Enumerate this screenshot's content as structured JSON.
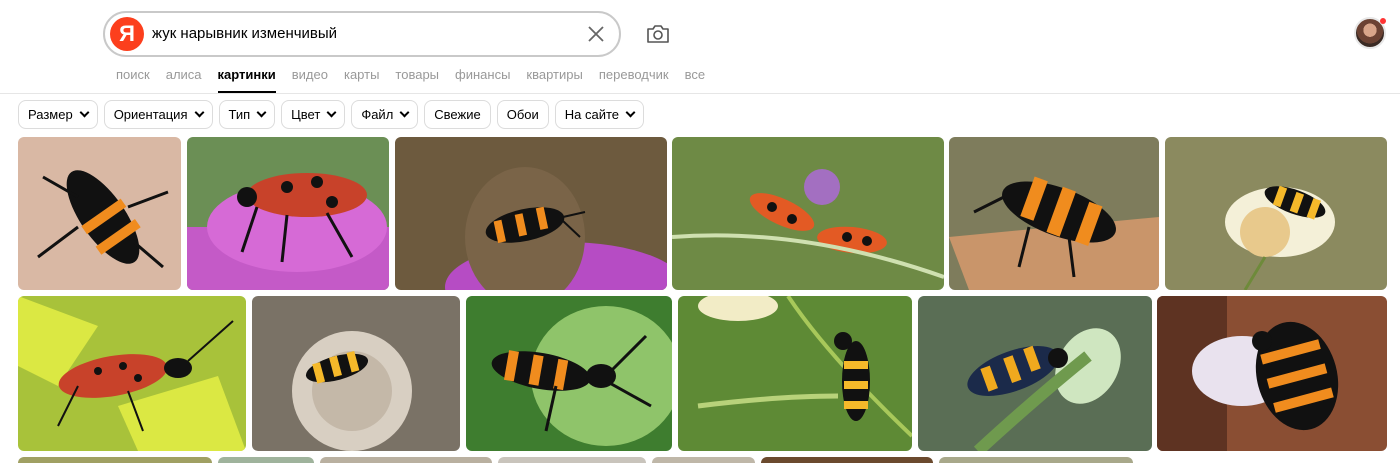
{
  "search": {
    "query": "жук нарывник изменчивый",
    "logo_letter": "Я"
  },
  "tabs": [
    {
      "label": "поиск",
      "active": false
    },
    {
      "label": "алиса",
      "active": false
    },
    {
      "label": "картинки",
      "active": true
    },
    {
      "label": "видео",
      "active": false
    },
    {
      "label": "карты",
      "active": false
    },
    {
      "label": "товары",
      "active": false
    },
    {
      "label": "финансы",
      "active": false
    },
    {
      "label": "квартиры",
      "active": false
    },
    {
      "label": "переводчик",
      "active": false
    },
    {
      "label": "все",
      "active": false
    }
  ],
  "filters": [
    {
      "label": "Размер",
      "dropdown": true
    },
    {
      "label": "Ориентация",
      "dropdown": true
    },
    {
      "label": "Тип",
      "dropdown": true
    },
    {
      "label": "Цвет",
      "dropdown": true
    },
    {
      "label": "Файл",
      "dropdown": true
    },
    {
      "label": "Свежие",
      "dropdown": false
    },
    {
      "label": "Обои",
      "dropdown": false
    },
    {
      "label": "На сайте",
      "dropdown": true
    }
  ],
  "colors": {
    "logo": "#fc3f1d",
    "active_tab": "#000000",
    "inactive_tab": "#999999"
  },
  "icons": [
    "clear-icon",
    "camera-icon",
    "chevron-down-icon"
  ]
}
